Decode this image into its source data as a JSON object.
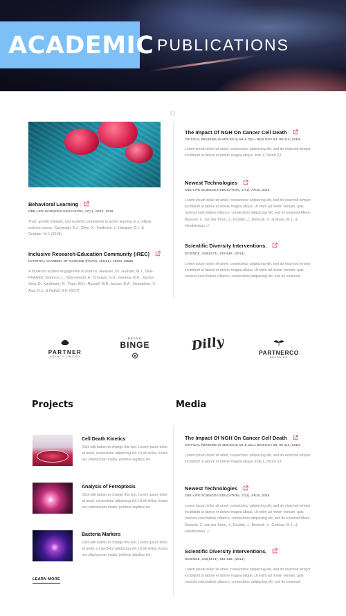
{
  "hero": {
    "title": "ACADEMIC",
    "subtitle": "PUBLICATIONS"
  },
  "left_publications": [
    {
      "title": "Behavioral Learning",
      "meta": "CBE-LIFE SCIENCES EDUCATION, 17(1), AR10,  2018",
      "text": "Trust, growth mindset, and student commitment to active learning in a college science course. Cavanagh, A.J., Chen, X., Frederick, J., Hanauer, D.I., & Graham, M.J. (2018)."
    },
    {
      "title": "Inclusive Research-Education Community (iREC)",
      "meta": "NATIONAL ACADEMY OF SCIENCE (PNAS), 114(51), 13531-13536.",
      "text": " A model for student engagement in science. Hanauer, D.I, Graham, M.J., SEA-PHAGES, Betancur, L., Bobrownicki, A., Cresawn, S.G., Garlena, R.A., Jacobs-Sera, D., Kaufmann, N., Pope, W.H., Russell, W.R. Jacobs, D.A., Sivanathan, V., Asai, D.J., & Hatfull, G.F. (2017)"
    }
  ],
  "right_publications": [
    {
      "title": "The Impact Of NGH On Cancer Cell Death",
      "meta": "CRITICAL REVIEWS IN MOLECULAR & CELL BIOLOGY 53. 99-114 (2018)",
      "text": "Lorem ipsum dolor sit amet, consectetur adipiscing elit, sed do eiusmod tempor incididunt ut labore et dolore magna aliqua.  Inde Z, Dixon SJ."
    },
    {
      "title": "Newest Technologies",
      "meta": "CBE-LIFE SCIENCES EDUCATION, 17(1), AR10,  2018",
      "text": "Lorem ipsum dolor sit amet, consectetur adipiscing elit, sed do eiusmod tempor incididunt ut labore et dolore magna aliqua. Ut enim ad minim veniam, quis nostrud exercitation ullamco, consectetur adipiscing elit, sed do eiusmod.Mess-Rasusin, C, van der Toorn, J., Dovidio, J., Brescoll, V., Graham, M.J., & Handelsman, J."
    },
    {
      "title": "Scientific Diversity Interventions.",
      "meta": "SCIENCE, 343(6171), 615-616. (2014).",
      "text": "Lorem ipsum dolor sit amet, consectetur adipiscing elit, sed do eiusmod tempor incididunt ut labore et dolore magna aliqua. Ut enim ad minim veniam, quis nostrud exercitation ullamco, consectetur adipiscing elit, sed do eiusmod."
    }
  ],
  "logos": [
    {
      "name": "PARTNER",
      "tag": "AGENCY LIMITED"
    },
    {
      "name": "BINGE",
      "tag": "BRAND"
    },
    {
      "name": "Dilly",
      "tag": ""
    },
    {
      "name": "PARTNERCO",
      "tag": "BRANDING"
    }
  ],
  "projects": {
    "heading": "Projects",
    "items": [
      {
        "title": "Cell Death Kinetics",
        "text": "Click edit button to change this text. Lorem ipsum dolor sit amet, consectetur adipiscing elit. Ut elit tellus, luctus nec ullamcorper mattis, pulvinar dapibus leo."
      },
      {
        "title": "Analysis of Ferroptosis",
        "text": "Click edit button to change this text. Lorem ipsum dolor sit amet, consectetur adipiscing elit. Ut elit tellus, luctus nec ullamcorper mattis, pulvinar dapibus leo."
      },
      {
        "title": "Bacteria Markers",
        "text": "Click edit button to change this text. Lorem ipsum dolor sit amet, consectetur adipiscing elit. Ut elit tellus, luctus nec ullamcorper mattis, pulvinar dapibus leo."
      }
    ],
    "learn_more": "LEARN MORE"
  },
  "media": {
    "heading": "Media",
    "items": [
      {
        "title": "The Impact Of NGH On Cancer Cell Death",
        "meta": "CRITICAL REVIEWS IN MOLECULAR & CELL BIOLOGY 53. 99-114 (2018)",
        "text": "Lorem ipsum dolor sit amet, consectetur adipiscing elit, sed do eiusmod tempor incididunt ut labore et dolore magna aliqua.  Inde Z, Dixon SJ."
      },
      {
        "title": "Newest Technologies",
        "meta": "CBE-LIFE SCIENCES EDUCATION, 17(1), AR10,  2018",
        "text": "Lorem ipsum dolor sit amet, consectetur adipiscing elit, sed do eiusmod tempor incididunt ut labore et dolore magna aliqua. Ut enim ad minim veniam, quis nostrud exercitation ullamco, consectetur adipiscing elit, sed do eiusmod.Mess-Rasusin, C, van der Toorn, J., Dovidio, J., Brescoll, V., Graham, M.J., & Handelsman, J."
      },
      {
        "title": "Scientific Diversity Interventions.",
        "meta": "SCIENCE, 343(6171), 615-616. (2014).",
        "text": "Lorem ipsum dolor sit amet, consectetur adipiscing elit, sed do eiusmod tempor incididunt ut labore et dolore magna aliqua. Ut enim ad minim veniam, quis nostrud exercitation ullamco, consectetur adipiscing elit, sed do eiusmod."
      }
    ]
  },
  "colors": {
    "accent_blue": "#7cc0f7",
    "link_icon": "#e8334a"
  },
  "icons": {
    "external": "external-link-icon"
  }
}
